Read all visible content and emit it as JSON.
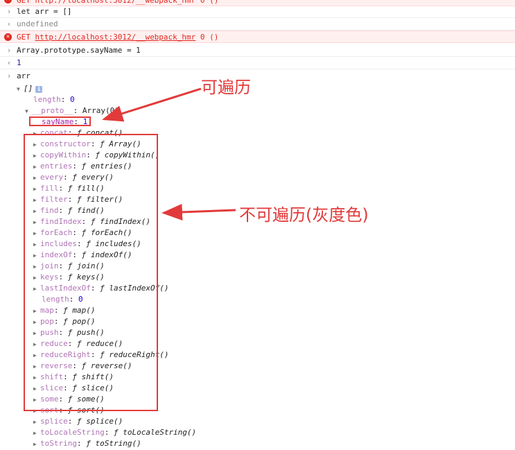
{
  "console": {
    "top_partial": "GET http://localhost:3012/__webpack_hmr 0 ()",
    "entries": [
      {
        "type": "input",
        "text": "let arr = []"
      },
      {
        "type": "output",
        "text": "undefined"
      },
      {
        "type": "error",
        "method": "GET",
        "url": "http://localhost:3012/__webpack_hmr",
        "status": "0 ()"
      },
      {
        "type": "input",
        "text": "Array.prototype.sayName = 1"
      },
      {
        "type": "output",
        "text": "1"
      },
      {
        "type": "input",
        "text": "arr"
      }
    ]
  },
  "tree": {
    "root": "[]",
    "length_key": "length",
    "length_value": "0",
    "proto_key": "__proto__",
    "proto_value": "Array(0)",
    "sayname_key": "sayName",
    "sayname_value": "1",
    "methods": [
      {
        "key": "concat",
        "value": "ƒ concat()"
      },
      {
        "key": "constructor",
        "value": "ƒ Array()"
      },
      {
        "key": "copyWithin",
        "value": "ƒ copyWithin()"
      },
      {
        "key": "entries",
        "value": "ƒ entries()"
      },
      {
        "key": "every",
        "value": "ƒ every()"
      },
      {
        "key": "fill",
        "value": "ƒ fill()"
      },
      {
        "key": "filter",
        "value": "ƒ filter()"
      },
      {
        "key": "find",
        "value": "ƒ find()"
      },
      {
        "key": "findIndex",
        "value": "ƒ findIndex()"
      },
      {
        "key": "forEach",
        "value": "ƒ forEach()"
      },
      {
        "key": "includes",
        "value": "ƒ includes()"
      },
      {
        "key": "indexOf",
        "value": "ƒ indexOf()"
      },
      {
        "key": "join",
        "value": "ƒ join()"
      },
      {
        "key": "keys",
        "value": "ƒ keys()"
      },
      {
        "key": "lastIndexOf",
        "value": "ƒ lastIndexOf()"
      },
      {
        "key": "length",
        "value": "0"
      },
      {
        "key": "map",
        "value": "ƒ map()"
      },
      {
        "key": "pop",
        "value": "ƒ pop()"
      },
      {
        "key": "push",
        "value": "ƒ push()"
      },
      {
        "key": "reduce",
        "value": "ƒ reduce()"
      },
      {
        "key": "reduceRight",
        "value": "ƒ reduceRight()"
      },
      {
        "key": "reverse",
        "value": "ƒ reverse()"
      },
      {
        "key": "shift",
        "value": "ƒ shift()"
      },
      {
        "key": "slice",
        "value": "ƒ slice()"
      },
      {
        "key": "some",
        "value": "ƒ some()"
      },
      {
        "key": "sort",
        "value": "ƒ sort()"
      },
      {
        "key": "splice",
        "value": "ƒ splice()"
      },
      {
        "key": "toLocaleString",
        "value": "ƒ toLocaleString()"
      },
      {
        "key": "toString",
        "value": "ƒ toString()"
      }
    ]
  },
  "annotations": {
    "enumerable": "可遍历",
    "non_enumerable": "不可遍历(灰度色)",
    "color": "#e23a3a"
  }
}
